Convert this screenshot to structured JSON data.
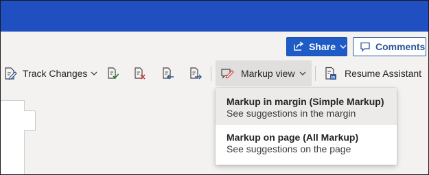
{
  "header": {
    "share_label": "Share",
    "comments_label": "Comments"
  },
  "ribbon": {
    "track_changes_label": "Track Changes",
    "markup_view_label": "Markup view",
    "resume_assistant_label": "Resume Assistant"
  },
  "markup_menu": {
    "items": [
      {
        "title": "Markup in margin (Simple Markup)",
        "description": "See suggestions in the margin",
        "highlighted": true
      },
      {
        "title": "Markup on page (All Markup)",
        "description": "See suggestions on the page",
        "highlighted": false
      }
    ]
  },
  "colors": {
    "titlebar": "#1f4fc0",
    "share_button": "#1f5bc6",
    "accent": "#2b579a",
    "reject_red": "#d13438",
    "accept_green": "#107c10"
  },
  "icons": {
    "share": "share-icon",
    "comments": "comment-icon",
    "track_changes": "track-changes-icon",
    "accept": "accept-change-icon",
    "reject": "reject-change-icon",
    "previous": "previous-change-icon",
    "next": "next-change-icon",
    "markup_view": "markup-view-icon",
    "resume_assistant": "resume-assistant-icon"
  }
}
